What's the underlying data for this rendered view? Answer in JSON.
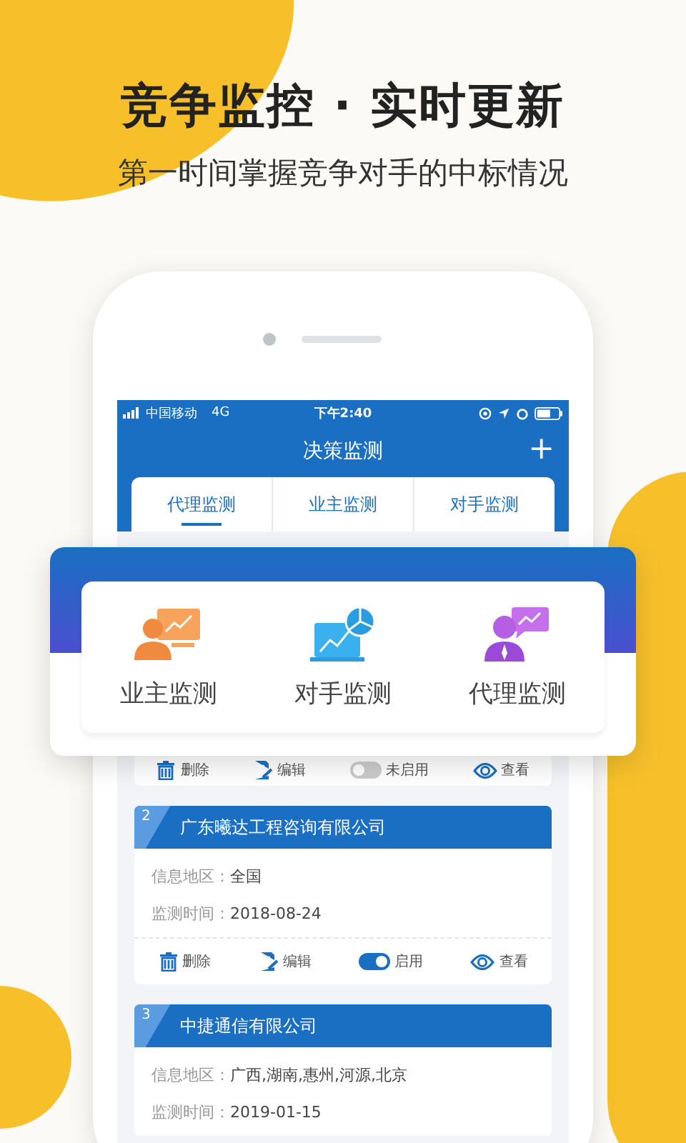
{
  "headline": "竞争监控 · 实时更新",
  "subheadline": "第一时间掌握竞争对手的中标情况",
  "status_bar": {
    "carrier": "中国移动",
    "network": "4G",
    "time": "下午2:40"
  },
  "nav": {
    "title": "决策监测",
    "add": "+"
  },
  "tabs": [
    {
      "label": "代理监测",
      "selected": true
    },
    {
      "label": "业主监测",
      "selected": false
    },
    {
      "label": "对手监测",
      "selected": false
    }
  ],
  "popup": {
    "items": [
      {
        "kind": "owner",
        "label": "业主监测"
      },
      {
        "kind": "rival",
        "label": "对手监测"
      },
      {
        "kind": "agent",
        "label": "代理监测"
      }
    ]
  },
  "cards": [
    {
      "actions": [
        {
          "kind": "delete",
          "label": "删除"
        },
        {
          "kind": "edit",
          "label": "编辑"
        },
        {
          "kind": "toggle",
          "label": "未启用",
          "on": false
        },
        {
          "kind": "view",
          "label": "查看"
        }
      ]
    },
    {
      "number": "2",
      "company": "广东曦达工程咨询有限公司",
      "fields": [
        {
          "label": "信息地区：",
          "value": "全国"
        },
        {
          "label": "监测时间：",
          "value": "2018-08-24"
        }
      ],
      "actions": [
        {
          "kind": "delete",
          "label": "删除"
        },
        {
          "kind": "edit",
          "label": "编辑"
        },
        {
          "kind": "toggle",
          "label": "启用",
          "on": true
        },
        {
          "kind": "view",
          "label": "查看"
        }
      ]
    },
    {
      "number": "3",
      "company": "中捷通信有限公司",
      "fields": [
        {
          "label": "信息地区：",
          "value": "广西,湖南,惠州,河源,北京"
        },
        {
          "label": "监测时间：",
          "value": "2019-01-15"
        }
      ]
    }
  ]
}
